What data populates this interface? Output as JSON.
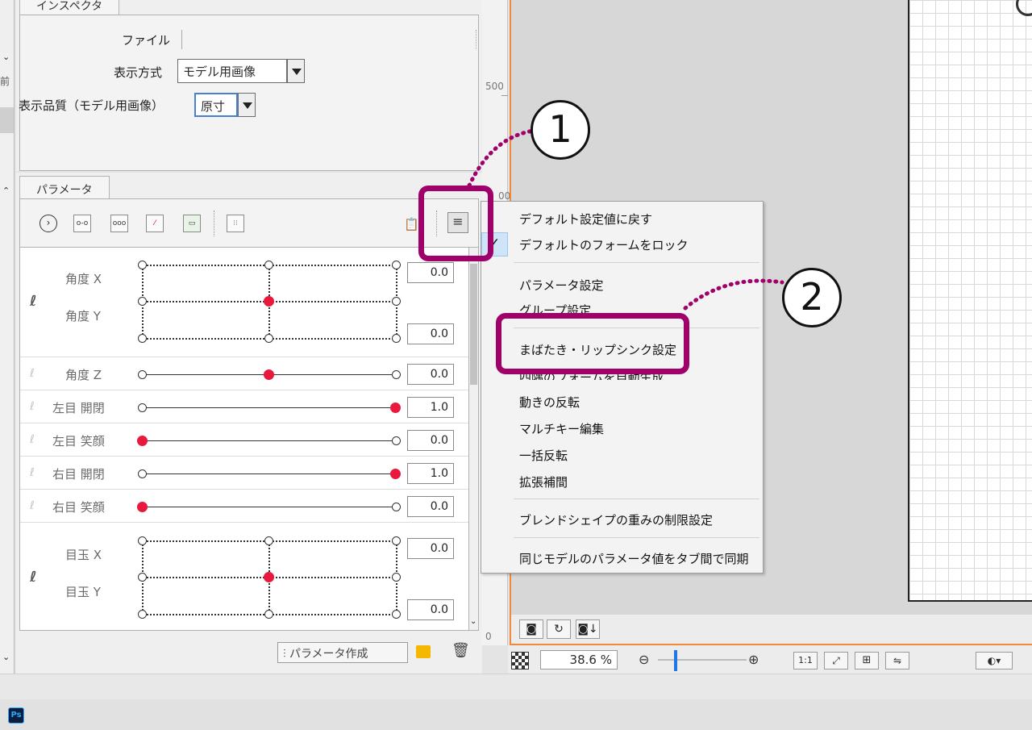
{
  "inspector": {
    "tab_label": "インスペクタ",
    "file_label": "ファイル",
    "file_value": "",
    "display_mode_label": "表示方式",
    "display_mode_value": "モデル用画像",
    "quality_label": "表示品質（モデル用画像）",
    "quality_value": "原寸"
  },
  "parameter_panel": {
    "tab_label": "パラメータ",
    "toolbar_icons": [
      "expand-icon",
      "add-param-icon",
      "add-multi-param-icon",
      "remove-param-icon",
      "param-display-icon",
      "grid-icon",
      "paste-icon",
      "menu-icon"
    ],
    "rows": [
      {
        "name": "角度 X",
        "value": "0.0"
      },
      {
        "name": "角度 Y",
        "value": "0.0"
      },
      {
        "name": "角度 Z",
        "value": "0.0"
      },
      {
        "name": "左目 開閉",
        "value": "1.0"
      },
      {
        "name": "左目 笑顔",
        "value": "0.0"
      },
      {
        "name": "右目 開閉",
        "value": "1.0"
      },
      {
        "name": "右目 笑顔",
        "value": "0.0"
      },
      {
        "name": "目玉 X",
        "value": "0.0"
      },
      {
        "name": "目玉 Y",
        "value": "0.0"
      }
    ],
    "create_button_label": "パラメータ作成"
  },
  "ruler": {
    "label_500": "500",
    "label_0": "0",
    "label_partial": "00"
  },
  "menu": {
    "items": [
      {
        "label": "デフォルト設定値に戻す",
        "checked": false
      },
      {
        "label": "デフォルトのフォームをロック",
        "checked": true
      },
      {
        "label": "パラメータ設定",
        "checked": false
      },
      {
        "label": "グループ設定",
        "checked": false
      },
      {
        "label": "まばたき・リップシンク設定",
        "checked": false
      },
      {
        "label": "四隅のフォームを自動生成",
        "checked": false
      },
      {
        "label": "動きの反転",
        "checked": false
      },
      {
        "label": "マルチキー編集",
        "checked": false
      },
      {
        "label": "一括反転",
        "checked": false
      },
      {
        "label": "拡張補間",
        "checked": false
      },
      {
        "label": "ブレンドシェイプの重みの制限設定",
        "checked": false
      },
      {
        "label": "同じモデルのパラメータ値をタブ間で同期",
        "checked": false
      }
    ],
    "check_mark": "✓"
  },
  "annotations": {
    "one": "1",
    "two": "2",
    "color": "#a0006a"
  },
  "zoom_bar": {
    "zoom_value": "38.6",
    "zoom_unit": "%",
    "ratio_button": "1:1"
  },
  "taskbar": {
    "app_icon_label": "Ps"
  },
  "colors": {
    "accent_red": "#e8193c",
    "canvas_border": "#f08a3a",
    "menu_check_bg": "#cfe4f7"
  }
}
